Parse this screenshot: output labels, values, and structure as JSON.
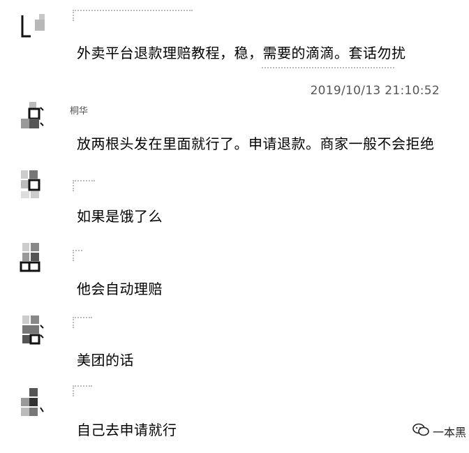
{
  "chat": {
    "messages": [
      {
        "name": "",
        "text": "外卖平台退款理赔教程，稳，需要的滴滴。套话勿扰"
      },
      {
        "name": "桐华",
        "text": "放两根头发在里面就行了。申请退款。商家一般不会拒绝"
      },
      {
        "name": "",
        "text": "如果是饿了么"
      },
      {
        "name": "",
        "text": "他会自动理赔"
      },
      {
        "name": "",
        "text": "美团的话"
      },
      {
        "name": "",
        "text": "自己去申请就行"
      }
    ],
    "timestamp": "2019/10/13 21:10:52"
  },
  "watermark": {
    "text": "一本黑"
  },
  "icons": {
    "avatar": "avatar-icon",
    "watermark": "wechat-icon"
  }
}
